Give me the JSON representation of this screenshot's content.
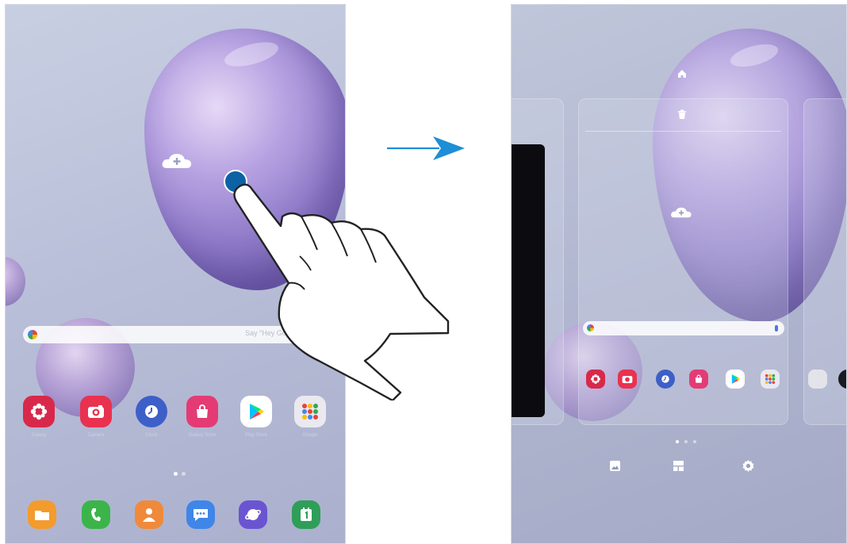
{
  "left_screen": {
    "search": {
      "placeholder": "Say \"Hey Google\""
    },
    "apps_row": [
      {
        "icon": "galaxy-store-icon",
        "label": "Galaxy",
        "color": "#d8294a"
      },
      {
        "icon": "camera-icon",
        "label": "Camera",
        "color": "#e8324f"
      },
      {
        "icon": "clock-icon",
        "label": "Clock",
        "color": "#3d5fc8"
      },
      {
        "icon": "galaxy-store-bag-icon",
        "label": "Galaxy Store",
        "color": "#e43b74"
      },
      {
        "icon": "play-store-icon",
        "label": "Play Store",
        "color": "#ffffff"
      },
      {
        "icon": "google-folder-icon",
        "label": "Google",
        "color": "#e9e9ef"
      }
    ],
    "dock": [
      {
        "icon": "my-files-icon",
        "label": "My Files",
        "color": "#f39b2d"
      },
      {
        "icon": "phone-icon",
        "label": "Phone",
        "color": "#3bb54a"
      },
      {
        "icon": "contacts-icon",
        "label": "Contacts",
        "color": "#f08a3a"
      },
      {
        "icon": "messages-icon",
        "label": "Messages",
        "color": "#3f86e8"
      },
      {
        "icon": "internet-icon",
        "label": "Internet",
        "color": "#6b54d2"
      },
      {
        "icon": "calendar-icon",
        "label": "Calendar",
        "color": "#2f9e59"
      }
    ]
  },
  "right_screen": {
    "apps_row": [
      {
        "icon": "galaxy-store-icon",
        "color": "#d8294a"
      },
      {
        "icon": "camera-icon",
        "color": "#e8324f"
      },
      {
        "icon": "clock-icon",
        "color": "#3d5fc8"
      },
      {
        "icon": "galaxy-store-bag-icon",
        "color": "#e43b74"
      },
      {
        "icon": "play-store-icon",
        "color": "#ffffff"
      },
      {
        "icon": "google-folder-icon",
        "color": "#e9e9ef"
      }
    ],
    "edit_options": [
      {
        "icon": "wallpapers-icon",
        "label": "Wallpapers"
      },
      {
        "icon": "widgets-icon",
        "label": "Widgets"
      },
      {
        "icon": "settings-icon",
        "label": "Home screen settings"
      }
    ]
  },
  "colors": {
    "touch_point": "#0d62a6",
    "arrow": "#1e8ed6"
  }
}
